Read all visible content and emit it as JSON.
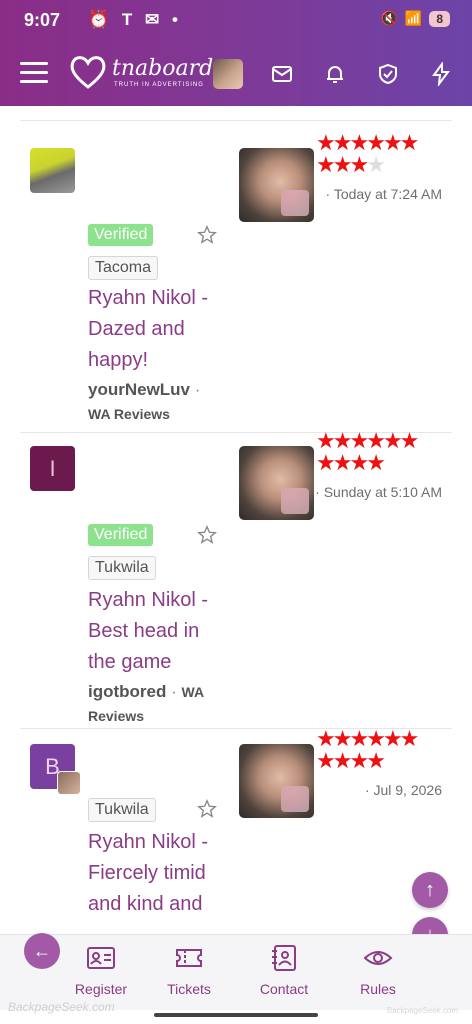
{
  "status_bar": {
    "time": "9:07",
    "notification_icons": "T",
    "battery": "8"
  },
  "header": {
    "logo_text": "tnaboard",
    "logo_tagline": "TRUTH IN ADVERTISING",
    "accent_color": "#8a2d87"
  },
  "posts": [
    {
      "rating": 9,
      "max_rating": 10,
      "date": "· Today at 7:24 AM",
      "verified": "Verified",
      "location": "Tacoma",
      "title": "Ryahn Nikol - Dazed and happy!",
      "author": "yourNewLuv",
      "separator": "·",
      "forum": "WA Reviews",
      "avatar": "photo"
    },
    {
      "rating": 10,
      "max_rating": 10,
      "date": "· Sunday at 5:10 AM",
      "verified": "Verified",
      "location": "Tukwila",
      "title": "Ryahn Nikol - Best head in the game",
      "author": "igotbored",
      "separator": "·",
      "forum": "WA Reviews",
      "avatar": "I"
    },
    {
      "rating": 10,
      "max_rating": 10,
      "date": "· Jul 9, 2026",
      "location": "Tukwila",
      "title": "Ryahn Nikol - Fiercely timid and kind and",
      "avatar": "B"
    }
  ],
  "bottom_nav": [
    {
      "label": "Register",
      "icon": "id-card-icon"
    },
    {
      "label": "Tickets",
      "icon": "ticket-icon"
    },
    {
      "label": "Contact",
      "icon": "contact-book-icon"
    },
    {
      "label": "Rules",
      "icon": "eye-icon"
    }
  ],
  "watermark": "BackpageSeek.com",
  "watermark_small": "BackpageSeek.com"
}
